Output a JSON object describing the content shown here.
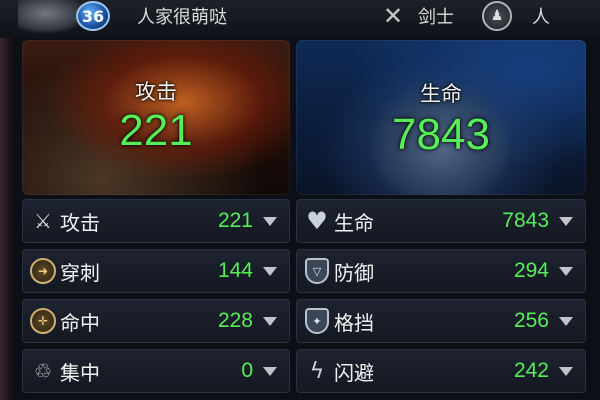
{
  "header": {
    "level": "36",
    "player_name": "人家很萌哒",
    "class_label": "剑士",
    "race_label": "人"
  },
  "panels": {
    "attack": {
      "label": "攻击",
      "value": "221"
    },
    "life": {
      "label": "生命",
      "value": "7843"
    }
  },
  "stats_left": [
    {
      "icon": "crossed-swords-icon",
      "label": "攻击",
      "value": "221"
    },
    {
      "icon": "pierce-icon",
      "label": "穿刺",
      "value": "144"
    },
    {
      "icon": "target-icon",
      "label": "命中",
      "value": "228"
    },
    {
      "icon": "focus-icon",
      "label": "集中",
      "value": "0"
    }
  ],
  "stats_right": [
    {
      "icon": "heart-icon",
      "label": "生命",
      "value": "7843"
    },
    {
      "icon": "shield-icon",
      "label": "防御",
      "value": "294"
    },
    {
      "icon": "block-shield-icon",
      "label": "格挡",
      "value": "256"
    },
    {
      "icon": "lightning-icon",
      "label": "闪避",
      "value": "242"
    }
  ],
  "colors": {
    "value_green": "#56ef58",
    "level_badge_blue": "#2a7fd8"
  }
}
